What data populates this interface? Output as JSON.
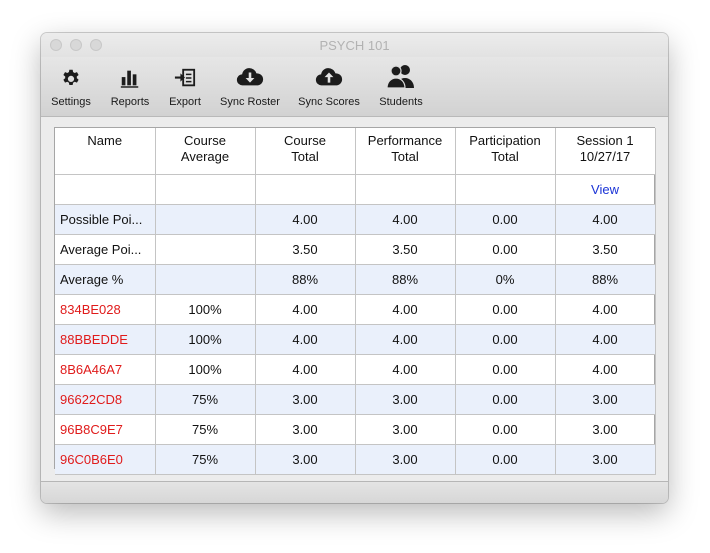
{
  "window": {
    "title": "PSYCH 101"
  },
  "toolbar": {
    "items": [
      {
        "label": "Settings",
        "icon": "gear-icon"
      },
      {
        "label": "Reports",
        "icon": "bar-chart-icon"
      },
      {
        "label": "Export",
        "icon": "export-icon"
      },
      {
        "label": "Sync Roster",
        "icon": "cloud-download-icon"
      },
      {
        "label": "Sync Scores",
        "icon": "cloud-upload-icon"
      },
      {
        "label": "Students",
        "icon": "people-icon"
      }
    ]
  },
  "table": {
    "headers": [
      {
        "line1": "Name",
        "line2": ""
      },
      {
        "line1": "Course",
        "line2": "Average"
      },
      {
        "line1": "Course",
        "line2": "Total"
      },
      {
        "line1": "Performance",
        "line2": "Total"
      },
      {
        "line1": "Participation",
        "line2": "Total"
      },
      {
        "line1": "Session 1",
        "line2": "10/27/17"
      }
    ],
    "link_row": {
      "session_link": "View"
    },
    "summary_rows": [
      {
        "name": "Possible Poi...",
        "course_average": "",
        "course_total": "4.00",
        "performance_total": "4.00",
        "participation_total": "0.00",
        "session1": "4.00"
      },
      {
        "name": "Average Poi...",
        "course_average": "",
        "course_total": "3.50",
        "performance_total": "3.50",
        "participation_total": "0.00",
        "session1": "3.50"
      },
      {
        "name": "Average %",
        "course_average": "",
        "course_total": "88%",
        "performance_total": "88%",
        "participation_total": "0%",
        "session1": "88%"
      }
    ],
    "student_rows": [
      {
        "name": "834BE028",
        "course_average": "100%",
        "course_total": "4.00",
        "performance_total": "4.00",
        "participation_total": "0.00",
        "session1": "4.00"
      },
      {
        "name": "88BBEDDE",
        "course_average": "100%",
        "course_total": "4.00",
        "performance_total": "4.00",
        "participation_total": "0.00",
        "session1": "4.00"
      },
      {
        "name": "8B6A46A7",
        "course_average": "100%",
        "course_total": "4.00",
        "performance_total": "4.00",
        "participation_total": "0.00",
        "session1": "4.00"
      },
      {
        "name": "96622CD8",
        "course_average": "75%",
        "course_total": "3.00",
        "performance_total": "3.00",
        "participation_total": "0.00",
        "session1": "3.00"
      },
      {
        "name": "96B8C9E7",
        "course_average": "75%",
        "course_total": "3.00",
        "performance_total": "3.00",
        "participation_total": "0.00",
        "session1": "3.00"
      },
      {
        "name": "96C0B6E0",
        "course_average": "75%",
        "course_total": "3.00",
        "performance_total": "3.00",
        "participation_total": "0.00",
        "session1": "3.00"
      }
    ]
  },
  "colors": {
    "student_name": "#e01b1b",
    "link": "#1a33d6",
    "alt_row": "#eaf0fb"
  }
}
